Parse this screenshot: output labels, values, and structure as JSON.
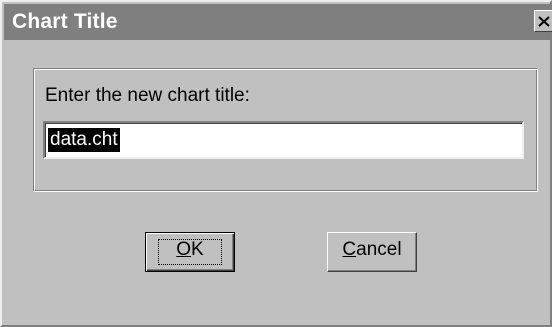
{
  "window": {
    "title": "Chart Title",
    "close_glyph": "×"
  },
  "prompt": {
    "label": "Enter the new chart title:"
  },
  "input": {
    "value": "data.cht",
    "selected": true
  },
  "buttons": {
    "ok": {
      "mnemonic": "O",
      "rest": "K",
      "is_default": true
    },
    "cancel": {
      "mnemonic": "C",
      "rest": "ancel"
    }
  },
  "colors": {
    "titlebar": "#7f7f7f",
    "face": "#c0c0c0",
    "selection": "#000000"
  }
}
